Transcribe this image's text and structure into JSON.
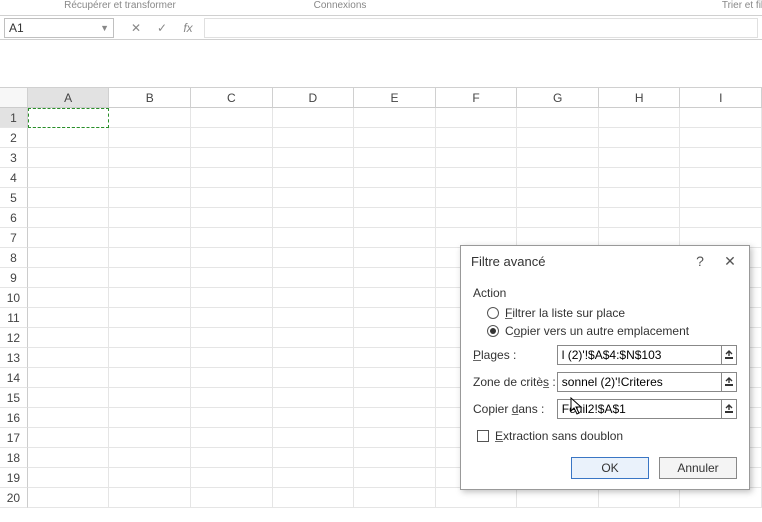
{
  "ribbon": {
    "group1": "Récupérer et transformer",
    "group2": "Connexions",
    "group3": "Trier et filtrer"
  },
  "namebox": {
    "ref": "A1"
  },
  "fx": {
    "label": "fx"
  },
  "columns": [
    "A",
    "B",
    "C",
    "D",
    "E",
    "F",
    "G",
    "H",
    "I"
  ],
  "rows": [
    "1",
    "2",
    "3",
    "4",
    "5",
    "6",
    "7",
    "8",
    "9",
    "10",
    "11",
    "12",
    "13",
    "14",
    "15",
    "16",
    "17",
    "18",
    "19",
    "20"
  ],
  "dialog": {
    "title": "Filtre avancé",
    "help": "?",
    "action_label": "Action",
    "radio_filter": "Filtrer la liste sur place",
    "radio_copy": "Copier vers un autre emplacement",
    "field_plages_label": "Plages :",
    "field_plages_value": "l (2)'!$A$4:$N$103",
    "field_criteres_label": "Zone de critères :",
    "field_criteres_value": "sonnel (2)'!Criteres",
    "field_copier_label": "Copier dans :",
    "field_copier_value": "Feuil2!$A$1",
    "chk_label": "Extraction sans doublon",
    "ok": "OK",
    "cancel": "Annuler"
  }
}
